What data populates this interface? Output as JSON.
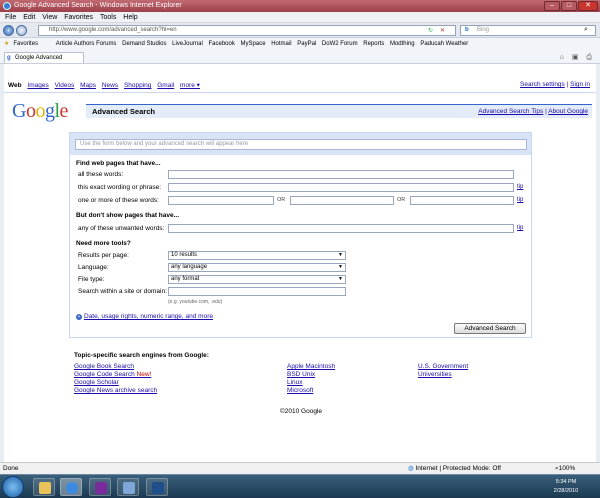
{
  "window": {
    "title": "Google Advanced Search - Windows Internet Explorer"
  },
  "menu": [
    "File",
    "Edit",
    "View",
    "Favorites",
    "Tools",
    "Help"
  ],
  "address": {
    "url": "http://www.google.com/advanced_search?hl=en",
    "search_placeholder": "Bing"
  },
  "favorites": {
    "label": "Favorites",
    "items": [
      "Article Authors Forums",
      "Demand Studios",
      "LiveJournal",
      "Facebook",
      "MySpace",
      "Hotmail",
      "PayPal",
      "DoW2 Forum",
      "Reports",
      "Modthing",
      "Paducah Weather"
    ]
  },
  "tab": {
    "title": "Google Advanced Search"
  },
  "gnav": {
    "items": [
      "Web",
      "Images",
      "Videos",
      "Maps",
      "News",
      "Shopping",
      "Gmail",
      "more ▾"
    ],
    "search_settings": "Search settings",
    "sign_in": "Sign in"
  },
  "logo": "Google",
  "header": {
    "title": "Advanced Search",
    "tips": "Advanced Search Tips",
    "about": "About Google"
  },
  "preview_placeholder": "Use the form below and your advanced search will appear here",
  "find": {
    "heading": "Find web pages that have...",
    "all_words": "all these words:",
    "exact": "this exact wording or phrase:",
    "one_or_more": "one or more of these words:",
    "or": "OR",
    "tip": "tip"
  },
  "dont": {
    "heading": "But don't show pages that have...",
    "unwanted": "any of these unwanted words:"
  },
  "tools": {
    "heading": "Need more tools?",
    "results_label": "Results per page:",
    "results_value": "10 results",
    "language_label": "Language:",
    "language_value": "any language",
    "filetype_label": "File type:",
    "filetype_value": "any format",
    "site_label": "Search within a site or domain:",
    "site_eg": "(e.g. youtube.com, .edu)"
  },
  "date_link": "Date, usage rights, numeric range, and more",
  "submit": "Advanced Search",
  "topic": {
    "heading": "Topic-specific search engines from Google:",
    "col1": [
      "Google Book Search",
      "Google Code Search",
      "Google Scholar",
      "Google News archive search"
    ],
    "new_badge": "New!",
    "col2": [
      "Apple Macintosh",
      "BSD Unix",
      "Linux",
      "Microsoft"
    ],
    "col3": [
      "U.S. Government",
      "Universities"
    ]
  },
  "copyright": "©2010 Google",
  "status": {
    "left": "Done",
    "zone": "Internet | Protected Mode: Off",
    "zoom": "100%"
  },
  "clock": {
    "time": "5:34 PM",
    "date": "2/28/2010"
  }
}
